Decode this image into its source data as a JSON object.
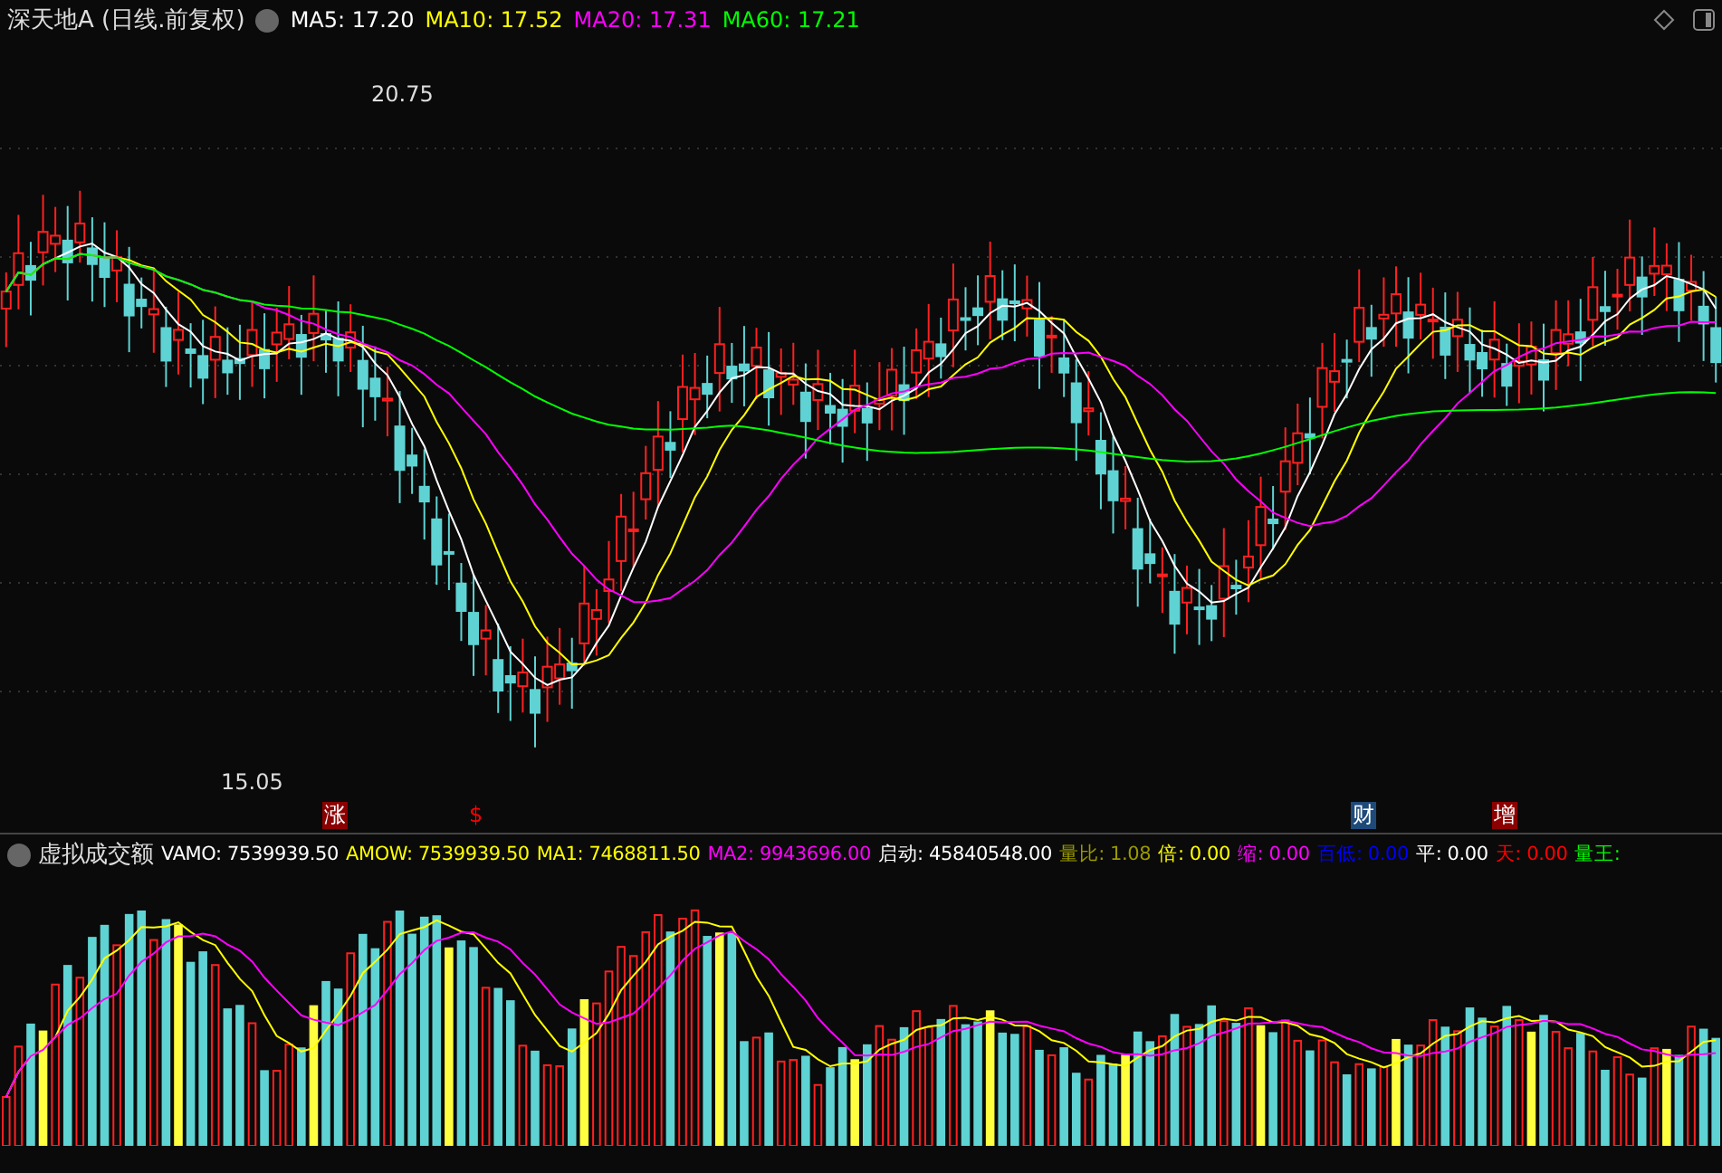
{
  "header": {
    "title": "深天地A (日线.前复权)",
    "indicators": [
      {
        "text": "MA5: 17.20",
        "color": "#ffffff"
      },
      {
        "text": "MA10: 17.52",
        "color": "#ffff00"
      },
      {
        "text": "MA20: 17.31",
        "color": "#ff00ff"
      },
      {
        "text": "MA60: 17.21",
        "color": "#00ff00"
      }
    ]
  },
  "price_labels": {
    "high": "20.75",
    "low": "15.05"
  },
  "markers": [
    {
      "text": "涨",
      "kind": "box",
      "color": "#8b0000"
    },
    {
      "text": "$",
      "kind": "plain",
      "color": "#ff0000"
    },
    {
      "text": "财",
      "kind": "box",
      "color": "#1e4a7a"
    },
    {
      "text": "增",
      "kind": "box",
      "color": "#8b0000"
    }
  ],
  "volume": {
    "title": "虚拟成交额",
    "indicators": [
      {
        "text": "VAMO: 7539939.50",
        "color": "#ffffff"
      },
      {
        "text": "AMOW: 7539939.50",
        "color": "#ffff00"
      },
      {
        "text": "MA1: 7468811.50",
        "color": "#ffff00"
      },
      {
        "text": "MA2: 9943696.00",
        "color": "#ff00ff"
      },
      {
        "text": "启动: 45840548.00",
        "color": "#ffffff"
      },
      {
        "text": "量比: 1.08",
        "color": "#999900"
      },
      {
        "text": "倍: 0.00",
        "color": "#ffff00"
      },
      {
        "text": "缩: 0.00",
        "color": "#ff00ff"
      },
      {
        "text": "百低: 0.00",
        "color": "#0000ff"
      },
      {
        "text": "平: 0.00",
        "color": "#ffffff"
      },
      {
        "text": "天: 0.00",
        "color": "#ff0000"
      },
      {
        "text": "量王:",
        "color": "#00ff00"
      }
    ]
  }
}
